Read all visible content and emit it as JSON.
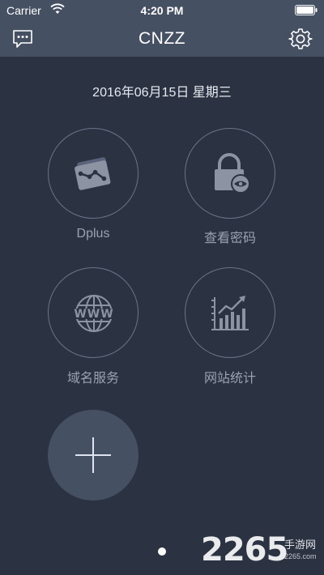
{
  "status_bar": {
    "carrier": "Carrier",
    "time": "4:20 PM"
  },
  "nav": {
    "title": "CNZZ",
    "left_icon": "message-icon",
    "right_icon": "gear-icon"
  },
  "date_text": "2016年06月15日 星期三",
  "tiles": [
    {
      "label": "Dplus",
      "icon": "dplus-chart-icon"
    },
    {
      "label": "查看密码",
      "icon": "lock-eye-icon"
    },
    {
      "label": "域名服务",
      "icon": "www-globe-icon"
    },
    {
      "label": "网站统计",
      "icon": "bar-trend-icon"
    }
  ],
  "add_button_icon": "plus-icon",
  "watermark": {
    "number": "2265",
    "cn": "手游网",
    "url": "2265.com"
  },
  "colors": {
    "background": "#2b3343",
    "header": "#465063",
    "tile_border": "#6a7487",
    "label": "#9aa2b0"
  }
}
